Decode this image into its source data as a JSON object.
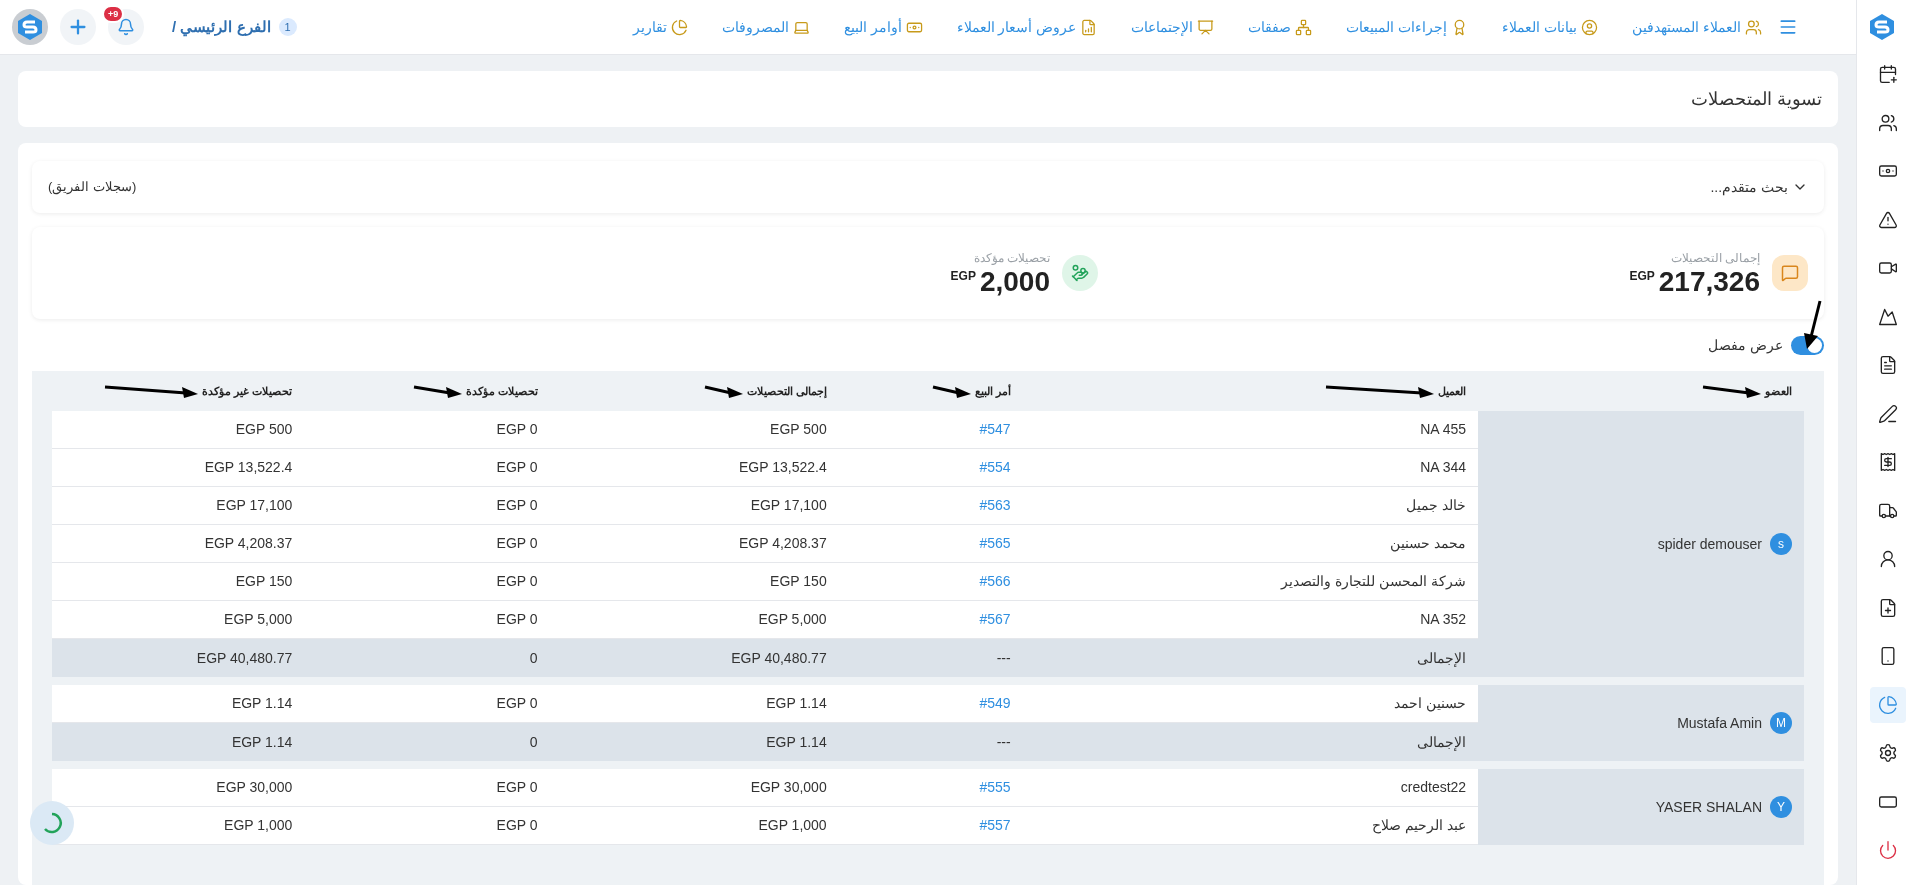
{
  "topbar": {
    "nav": [
      {
        "label": "العملاء المستهدفين"
      },
      {
        "label": "بيانات العملاء"
      },
      {
        "label": "إجراءات المبيعات"
      },
      {
        "label": "صفقات"
      },
      {
        "label": "الإجتماعات"
      },
      {
        "label": "عروض أسعار العملاء"
      },
      {
        "label": "أوامر البيع"
      },
      {
        "label": "المصروفات"
      },
      {
        "label": "تقارير"
      }
    ],
    "branch": {
      "number": "1",
      "name": "الفرع الرئيسي /"
    },
    "notifications": "+9"
  },
  "page_title": "تسوية المتحصلات",
  "filter": {
    "label": "بحث متقدم...",
    "scope": "(سجلات الفريق)"
  },
  "stats": [
    {
      "kind": "total",
      "label": "إجمالى التحصيلات",
      "value": "217,326",
      "currency": "EGP"
    },
    {
      "kind": "confirmed",
      "label": "تحصيلات مؤكدة",
      "value": "2,000",
      "currency": "EGP"
    }
  ],
  "detail_toggle": {
    "label": "عرض مفصل",
    "on": true
  },
  "table": {
    "columns": [
      "العضو",
      "العميل",
      "أمر البيع",
      "إجمالى التحصيلات",
      "تحصيلات مؤكدة",
      "تحصيلات غير مؤكدة"
    ],
    "groups": [
      {
        "member": "spider demouser",
        "initial": "s",
        "rows": [
          {
            "client": "NA 455",
            "order": "#547",
            "total": "EGP 500",
            "confirmed": "EGP 0",
            "unconfirmed": "EGP 500"
          },
          {
            "client": "NA 344",
            "order": "#554",
            "total": "EGP 13,522.4",
            "confirmed": "EGP 0",
            "unconfirmed": "EGP 13,522.4"
          },
          {
            "client": "خالد جميل",
            "order": "#563",
            "total": "EGP 17,100",
            "confirmed": "EGP 0",
            "unconfirmed": "EGP 17,100"
          },
          {
            "client": "محمد حسنين",
            "order": "#565",
            "total": "EGP 4,208.37",
            "confirmed": "EGP 0",
            "unconfirmed": "EGP 4,208.37"
          },
          {
            "client": "شركة المحسن للتجارة والتصدير",
            "order": "#566",
            "total": "EGP 150",
            "confirmed": "EGP 0",
            "unconfirmed": "EGP 150"
          },
          {
            "client": "NA 352",
            "order": "#567",
            "total": "EGP 5,000",
            "confirmed": "EGP 0",
            "unconfirmed": "EGP 5,000"
          }
        ],
        "total_row": {
          "label": "الإجمالى",
          "order": "---",
          "total": "EGP 40,480.77",
          "confirmed": "0",
          "unconfirmed": "EGP 40,480.77"
        }
      },
      {
        "member": "Mustafa Amin",
        "initial": "M",
        "rows": [
          {
            "client": "حسنين احمد",
            "order": "#549",
            "total": "EGP 1.14",
            "confirmed": "EGP 0",
            "unconfirmed": "EGP 1.14"
          }
        ],
        "total_row": {
          "label": "الإجمالى",
          "order": "---",
          "total": "EGP 1.14",
          "confirmed": "0",
          "unconfirmed": "EGP 1.14"
        }
      },
      {
        "member": "YASER SHALAN",
        "initial": "Y",
        "rows": [
          {
            "client": "credtest22",
            "order": "#555",
            "total": "EGP 30,000",
            "confirmed": "EGP 0",
            "unconfirmed": "EGP 30,000"
          },
          {
            "client": "عبد الرحيم صلاح",
            "order": "#557",
            "total": "EGP 1,000",
            "confirmed": "EGP 0",
            "unconfirmed": "EGP 1,000"
          }
        ]
      }
    ]
  },
  "sidebar": {
    "items": [
      {
        "selected": false
      },
      {
        "selected": false
      },
      {
        "selected": false
      },
      {
        "selected": false
      },
      {
        "selected": false
      },
      {
        "selected": false
      },
      {
        "selected": false
      },
      {
        "selected": false
      },
      {
        "selected": false
      },
      {
        "selected": false
      },
      {
        "selected": false
      },
      {
        "selected": false
      },
      {
        "selected": false
      },
      {
        "selected": true
      },
      {
        "selected": false
      },
      {
        "selected": false
      },
      {
        "selected": false
      }
    ]
  }
}
